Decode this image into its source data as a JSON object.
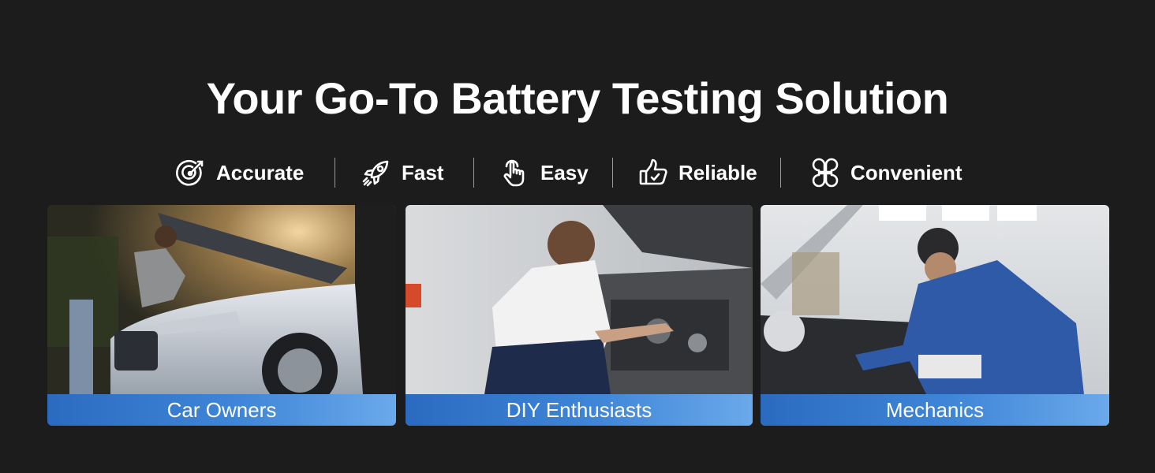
{
  "headline": "Your Go-To Battery Testing Solution",
  "features": [
    {
      "label": "Accurate",
      "icon": "target-icon"
    },
    {
      "label": "Fast",
      "icon": "rocket-icon"
    },
    {
      "label": "Easy",
      "icon": "pointer-hand-icon"
    },
    {
      "label": "Reliable",
      "icon": "thumbs-up-icon"
    },
    {
      "label": "Convenient",
      "icon": "four-petal-icon"
    }
  ],
  "cards": [
    {
      "caption": "Car Owners"
    },
    {
      "caption": "DIY Enthusiasts"
    },
    {
      "caption": "Mechanics"
    }
  ],
  "colors": {
    "background": "#1c1c1c",
    "caption_gradient_start": "#2a6bc0",
    "caption_gradient_end": "#6aa9ea"
  }
}
